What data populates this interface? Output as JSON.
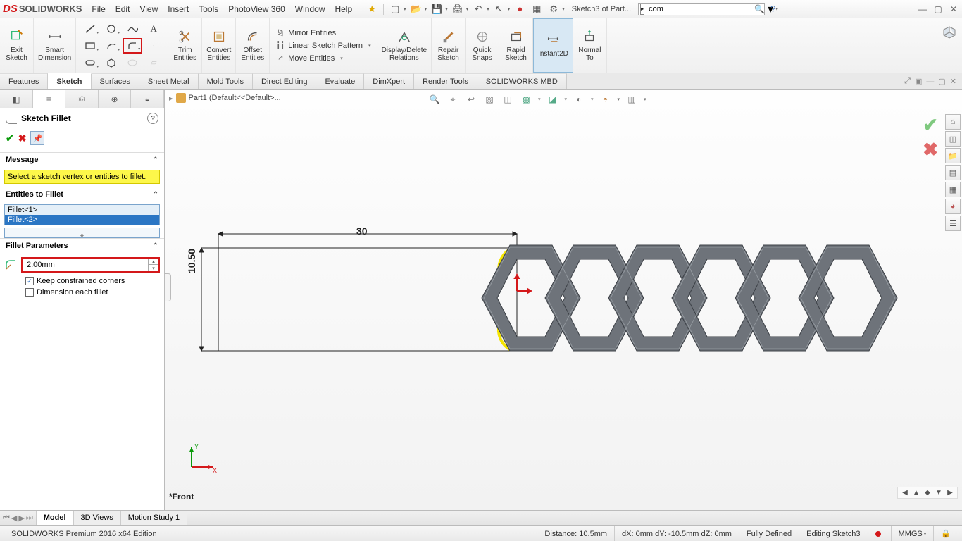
{
  "title": {
    "brand_ds": "DS",
    "brand": "SOLIDWORKS"
  },
  "menu": [
    "File",
    "Edit",
    "View",
    "Insert",
    "Tools",
    "PhotoView 360",
    "Window",
    "Help"
  ],
  "crumb": "Sketch3 of Part...",
  "search_value": "com",
  "ribbon": {
    "exit_sketch": "Exit\nSketch",
    "smart_dim": "Smart\nDimension",
    "trim": "Trim\nEntities",
    "convert": "Convert\nEntities",
    "offset": "Offset\nEntities",
    "mirror": "Mirror Entities",
    "linear": "Linear Sketch Pattern",
    "move": "Move Entities",
    "display": "Display/Delete\nRelations",
    "repair": "Repair\nSketch",
    "quick": "Quick\nSnaps",
    "rapid": "Rapid\nSketch",
    "instant2d": "Instant2D",
    "normal": "Normal\nTo"
  },
  "tabs": [
    "Features",
    "Sketch",
    "Surfaces",
    "Sheet Metal",
    "Mold Tools",
    "Direct Editing",
    "Evaluate",
    "DimXpert",
    "Render Tools",
    "SOLIDWORKS MBD"
  ],
  "active_tab_index": 1,
  "crumbbar": "Part1  (Default<<Default>...",
  "pm": {
    "title": "Sketch Fillet",
    "message_hdr": "Message",
    "message": "Select a sketch vertex or entities to fillet.",
    "entities_hdr": "Entities to Fillet",
    "entities": [
      "Fillet<1>",
      "Fillet<2>"
    ],
    "selected_entity_index": 1,
    "params_hdr": "Fillet Parameters",
    "radius": "2.00mm",
    "keep": "Keep constrained corners",
    "dim_each": "Dimension each fillet",
    "keep_checked": true,
    "dim_each_checked": false
  },
  "dims": {
    "horiz": "30",
    "vert": "10.50"
  },
  "viewname": "*Front",
  "bottom_tabs": [
    "Model",
    "3D Views",
    "Motion Study 1"
  ],
  "active_bottom_tab_index": 0,
  "status": {
    "edition": "SOLIDWORKS Premium 2016 x64 Edition",
    "distance": "Distance: 10.5mm",
    "dxyz": "dX: 0mm   dY: -10.5mm   dZ: 0mm",
    "defined": "Fully Defined",
    "editing": "Editing Sketch3",
    "units": "MMGS"
  }
}
